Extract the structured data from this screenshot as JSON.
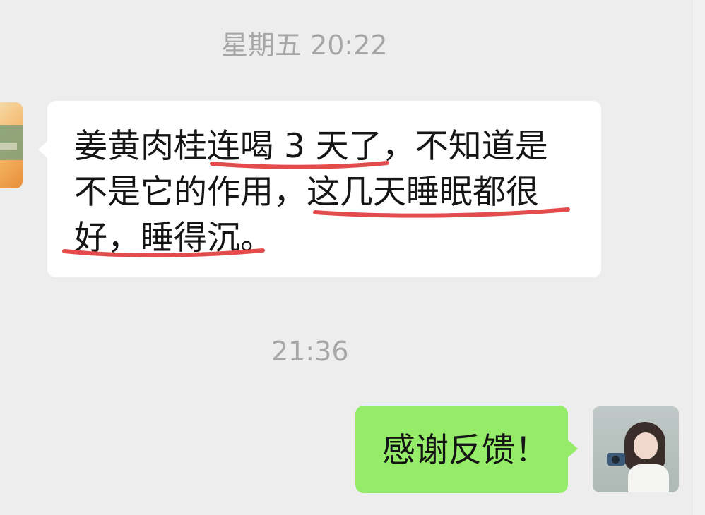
{
  "chat": {
    "timestamps": [
      "星期五 20:22",
      "21:36"
    ],
    "incoming_message": {
      "lines": [
        "姜黄肉桂连喝 3 天了，不知道是",
        "不是它的作用，这几天睡眠都很",
        "好，睡得沉。"
      ]
    },
    "outgoing_message": {
      "text": "感谢反馈！"
    }
  },
  "colors": {
    "background": "#ededed",
    "incoming_bubble": "#ffffff",
    "outgoing_bubble": "#95ec69",
    "timestamp": "#a7a7a7",
    "underline": "#e34c4c"
  }
}
